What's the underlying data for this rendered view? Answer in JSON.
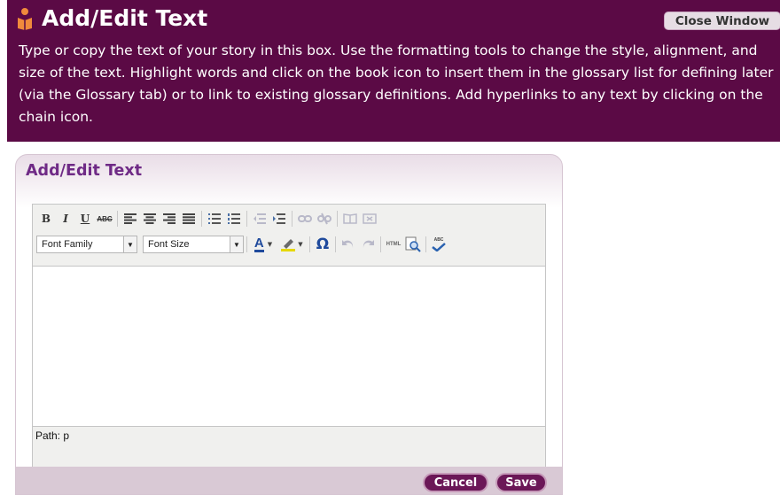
{
  "header": {
    "title": "Add/Edit Text",
    "close_label": "Close Window",
    "description": "Type or copy the text of your story in this box. Use the formatting tools to change the style, alignment, and size of the text. Highlight words and click on the book icon to insert them in the glossary list for defining later (via the Glossary tab) or to link to existing glossary definitions. Add hyperlinks to any text by clicking on the chain icon."
  },
  "panel": {
    "title": "Add/Edit Text",
    "font_family_label": "Font Family",
    "font_size_label": "Font Size",
    "path_label": "Path: p",
    "content": ""
  },
  "toolbar": {
    "bold": "B",
    "italic": "I",
    "underline": "U",
    "strike": "ABC",
    "text_color": "A",
    "special_char": "Ω",
    "html": "HTML",
    "spell": "ABC"
  },
  "buttons": {
    "cancel": "Cancel",
    "save": "Save"
  },
  "colors": {
    "header_bg": "#5b0a45",
    "accent": "#6f2a86",
    "button_bg": "#6b1757"
  }
}
